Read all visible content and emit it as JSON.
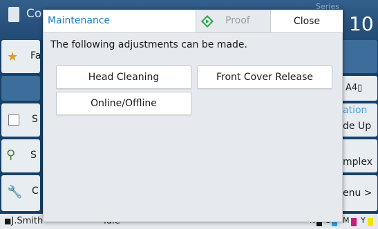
{
  "background": {
    "title_fragment": "Co",
    "series_label": "Series",
    "count_fragment": "10",
    "left_buttons": [
      {
        "label": "Fa"
      },
      {
        "label": "S"
      },
      {
        "label": "S"
      },
      {
        "label": "C"
      }
    ],
    "right_buttons": [
      {
        "label": "A4▯"
      },
      {
        "label": "de Up"
      },
      {
        "label": "mplex"
      },
      {
        "label": "enu >"
      }
    ],
    "right_accent_label": "ation",
    "status": {
      "user": "J.Smith",
      "state": "Idle",
      "inks": [
        {
          "label": "K",
          "color": "#1a1a1a"
        },
        {
          "label": "C",
          "color": "#27a3df"
        },
        {
          "label": "M",
          "color": "#c2207b"
        },
        {
          "label": "Y",
          "color": "#f2e500"
        }
      ]
    }
  },
  "dialog": {
    "title": "Maintenance",
    "proof_label": "Proof",
    "close_label": "Close",
    "message": "The following adjustments can be made.",
    "buttons": {
      "head_cleaning": "Head Cleaning",
      "front_cover_release": "Front Cover Release",
      "online_offline": "Online/Offline"
    }
  },
  "colors": {
    "accent": "#1b7ec3",
    "proof_icon": "#2aa84a",
    "background_panel": "#15416a"
  }
}
